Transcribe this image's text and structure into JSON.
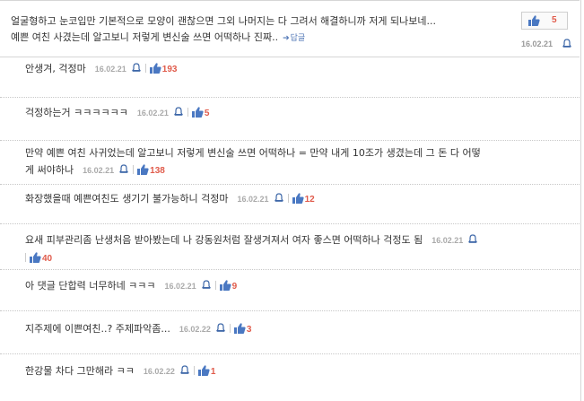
{
  "top_comment": {
    "line1": "얼굴형하고 눈코입만 기본적으로 모양이 괜찮으면 그외 나머지는 다 그려서 해결하니까 저게 되나보네...",
    "line2": "예쁜 여친 사겼는데 알고보니 저렇게 변신술 쓰면 어떡하나 진짜..",
    "reply_label": "답글",
    "like_count": "5",
    "date": "16.02.21"
  },
  "replies": [
    {
      "text": "안생겨, 걱정마",
      "date": "16.02.21",
      "likes": "193"
    },
    {
      "text": "걱정하는거 ㅋㅋㅋㅋㅋㅋ",
      "date": "16.02.21",
      "likes": "5"
    },
    {
      "text_line1": "만약 예쁜 여친 사귀었는데 알고보니 저렇게 변신술 쓰면 어떡하나 = 만약 내게 10조가 생겼는데 그 돈 다 어떻",
      "text_line2": "게 써야하나",
      "date": "16.02.21",
      "likes": "138"
    },
    {
      "text": "화장했을때 예쁜여친도 생기기 불가능하니 걱정마",
      "date": "16.02.21",
      "likes": "12"
    },
    {
      "text_line1": "요새 피부관리좀 난생처음 받아봤는데 나 강동원처럼 잘생겨져서 여자 좋스면 어떡하나 걱정도 됨",
      "date": "16.02.21",
      "likes": "40"
    },
    {
      "text": "아 댓글 단합력 너무하네 ㅋㅋㅋ",
      "date": "16.02.21",
      "likes": "9"
    },
    {
      "text": "지주제에 이쁜여친..? 주제파악좀...",
      "date": "16.02.22",
      "likes": "3"
    },
    {
      "text": "한강물 차다 그만해라 ㅋㅋ",
      "date": "16.02.22",
      "likes": "1"
    }
  ],
  "colors": {
    "like_red": "#e05b4b",
    "link_blue": "#5177b6",
    "icon_blue": "#4a78c2"
  }
}
